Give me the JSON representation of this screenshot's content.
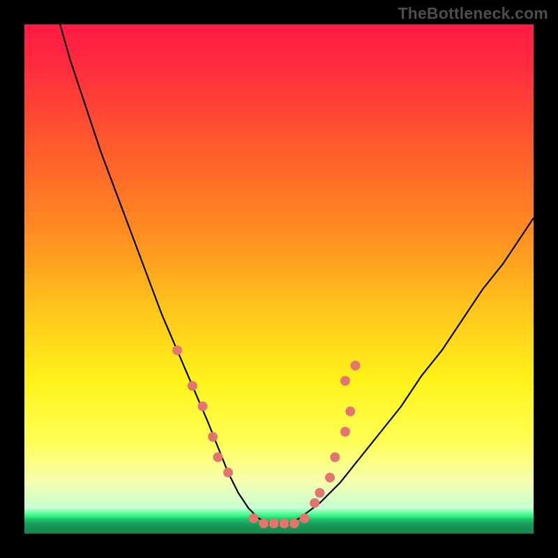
{
  "watermark": {
    "text": "TheBottleneck.com"
  },
  "chart_data": {
    "type": "line",
    "title": "",
    "xlabel": "",
    "ylabel": "",
    "xlim": [
      0,
      100
    ],
    "ylim": [
      0,
      100
    ],
    "background_gradient_stops": [
      {
        "offset": 0.0,
        "color": "#ff1b43"
      },
      {
        "offset": 0.08,
        "color": "#ff2b3f"
      },
      {
        "offset": 0.24,
        "color": "#ff5b2c"
      },
      {
        "offset": 0.4,
        "color": "#ff8a22"
      },
      {
        "offset": 0.55,
        "color": "#ffc21c"
      },
      {
        "offset": 0.7,
        "color": "#fff31a"
      },
      {
        "offset": 0.82,
        "color": "#ffff55"
      },
      {
        "offset": 0.9,
        "color": "#f5ffb0"
      },
      {
        "offset": 0.95,
        "color": "#c6ffd3"
      },
      {
        "offset": 0.965,
        "color": "#31f884"
      },
      {
        "offset": 0.972,
        "color": "#1fc36c"
      },
      {
        "offset": 0.978,
        "color": "#1ba860"
      },
      {
        "offset": 0.985,
        "color": "#189556"
      },
      {
        "offset": 1.0,
        "color": "#16834c"
      }
    ],
    "series": [
      {
        "name": "bottleneck-curve",
        "x": [
          7,
          9,
          12,
          15,
          18,
          21,
          24,
          27,
          30,
          33,
          36,
          38,
          40,
          42,
          44,
          46,
          48,
          50,
          52,
          54,
          58,
          62,
          66,
          70,
          74,
          78,
          82,
          86,
          90,
          94,
          98,
          100
        ],
        "y": [
          100,
          93,
          84,
          75,
          67,
          59,
          51,
          43,
          36,
          29,
          22,
          17,
          12,
          8,
          5,
          3,
          2,
          2,
          2,
          3,
          6,
          10,
          15,
          20,
          25,
          31,
          36,
          42,
          48,
          53,
          59,
          62
        ]
      }
    ],
    "scatter_overlay": {
      "name": "highlight-dots",
      "color": "#e4756e",
      "radius": 7,
      "points": [
        {
          "x": 30,
          "y": 36
        },
        {
          "x": 33,
          "y": 29
        },
        {
          "x": 35,
          "y": 25
        },
        {
          "x": 37,
          "y": 19
        },
        {
          "x": 38,
          "y": 15
        },
        {
          "x": 40,
          "y": 12
        },
        {
          "x": 45,
          "y": 3
        },
        {
          "x": 47,
          "y": 2
        },
        {
          "x": 49,
          "y": 2
        },
        {
          "x": 51,
          "y": 2
        },
        {
          "x": 53,
          "y": 2
        },
        {
          "x": 55,
          "y": 3
        },
        {
          "x": 57,
          "y": 6
        },
        {
          "x": 58,
          "y": 8
        },
        {
          "x": 60,
          "y": 11
        },
        {
          "x": 61,
          "y": 15
        },
        {
          "x": 63,
          "y": 20
        },
        {
          "x": 64,
          "y": 24
        },
        {
          "x": 63,
          "y": 30
        },
        {
          "x": 65,
          "y": 33
        }
      ]
    }
  }
}
